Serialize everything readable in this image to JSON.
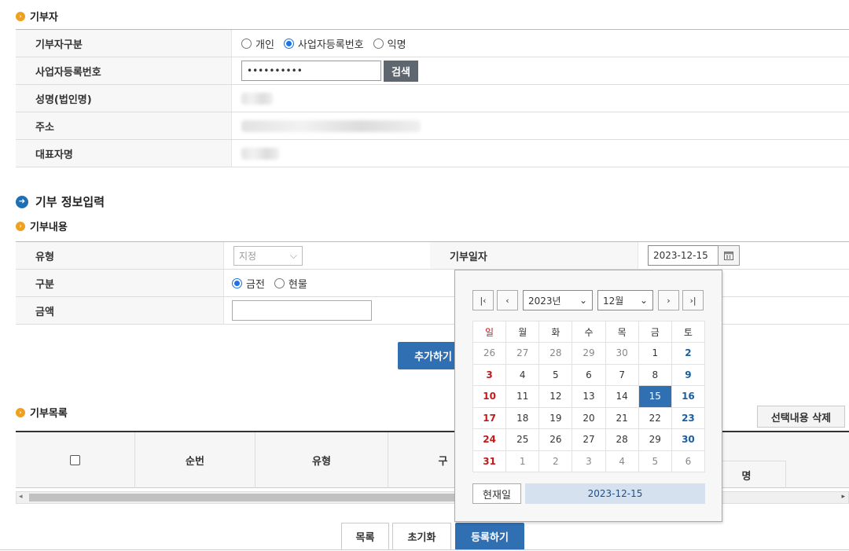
{
  "donor_section": {
    "title": "기부자",
    "type_label": "기부자구분",
    "type_options": [
      "개인",
      "사업자등록번호",
      "익명"
    ],
    "type_selected": 1,
    "bizno_label": "사업자등록번호",
    "bizno_value": "••••••••••",
    "search_button": "검색",
    "name_label": "성명(법인명)",
    "address_label": "주소",
    "ceo_label": "대표자명"
  },
  "donation_info": {
    "title": "기부 정보입력",
    "content_title": "기부내용",
    "type_label": "유형",
    "type_select": "지정",
    "date_label": "기부일자",
    "date_value": "2023-12-15",
    "kind_label": "구분",
    "kind_options": [
      "금전",
      "현물"
    ],
    "kind_selected": 0,
    "amount_label": "금액",
    "amount_value": "",
    "add_button": "추가하기"
  },
  "donation_list": {
    "title": "기부목록",
    "delete_button": "선택내용 삭제",
    "col_seq": "순번",
    "col_type": "유형",
    "col_kind_partial": "구",
    "col_name_partial": "명"
  },
  "footer": {
    "list_button": "목록",
    "reset_button": "초기화",
    "register_button": "등록하기"
  },
  "calendar": {
    "year_select": "2023년",
    "month_select": "12월",
    "weekdays": [
      "일",
      "월",
      "화",
      "수",
      "목",
      "금",
      "토"
    ],
    "weeks": [
      [
        "26",
        "27",
        "28",
        "29",
        "30",
        "1",
        "2"
      ],
      [
        "3",
        "4",
        "5",
        "6",
        "7",
        "8",
        "9"
      ],
      [
        "10",
        "11",
        "12",
        "13",
        "14",
        "15",
        "16"
      ],
      [
        "17",
        "18",
        "19",
        "20",
        "21",
        "22",
        "23"
      ],
      [
        "24",
        "25",
        "26",
        "27",
        "28",
        "29",
        "30"
      ],
      [
        "31",
        "1",
        "2",
        "3",
        "4",
        "5",
        "6"
      ]
    ],
    "selected_day": "15",
    "today_button": "현재일",
    "today_value": "2023-12-15",
    "colors": {
      "accent": "#2f6fb2",
      "sunday": "#c21a1a",
      "saturday": "#1b5fa0"
    }
  }
}
